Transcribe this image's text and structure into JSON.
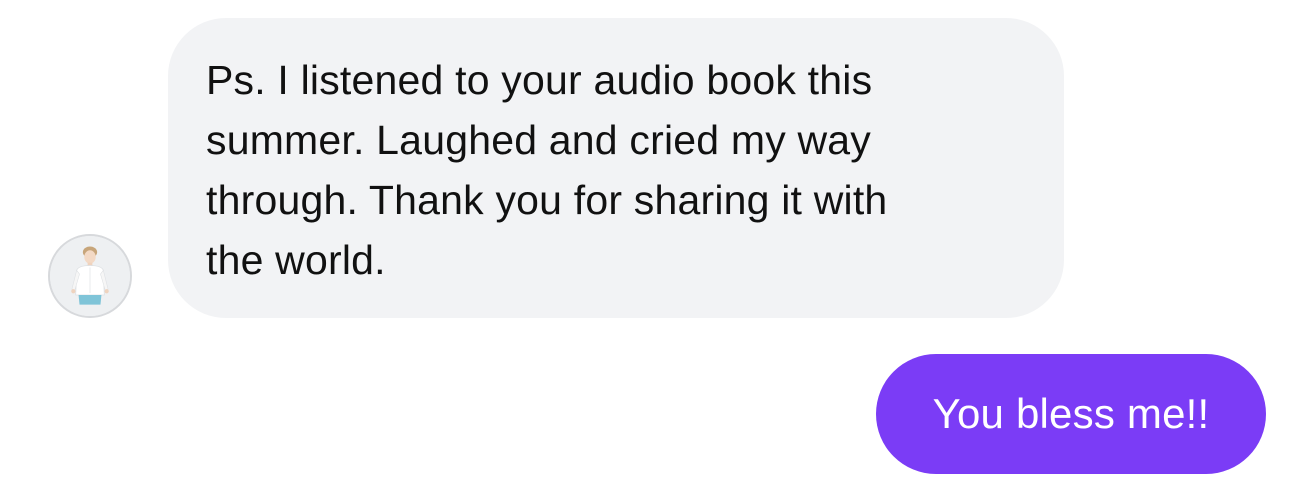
{
  "conversation": {
    "incoming_message": {
      "text": "Ps. I listened to your audio book this\nsummer. Laughed and cried my way\nthrough. Thank you for sharing it with\nthe world.",
      "bubble_color": "#f2f3f5"
    },
    "outgoing_message": {
      "text": "You bless me!!",
      "bubble_color": "#7b3cf6"
    },
    "sender_avatar": {
      "icon": "profile-photo"
    }
  }
}
